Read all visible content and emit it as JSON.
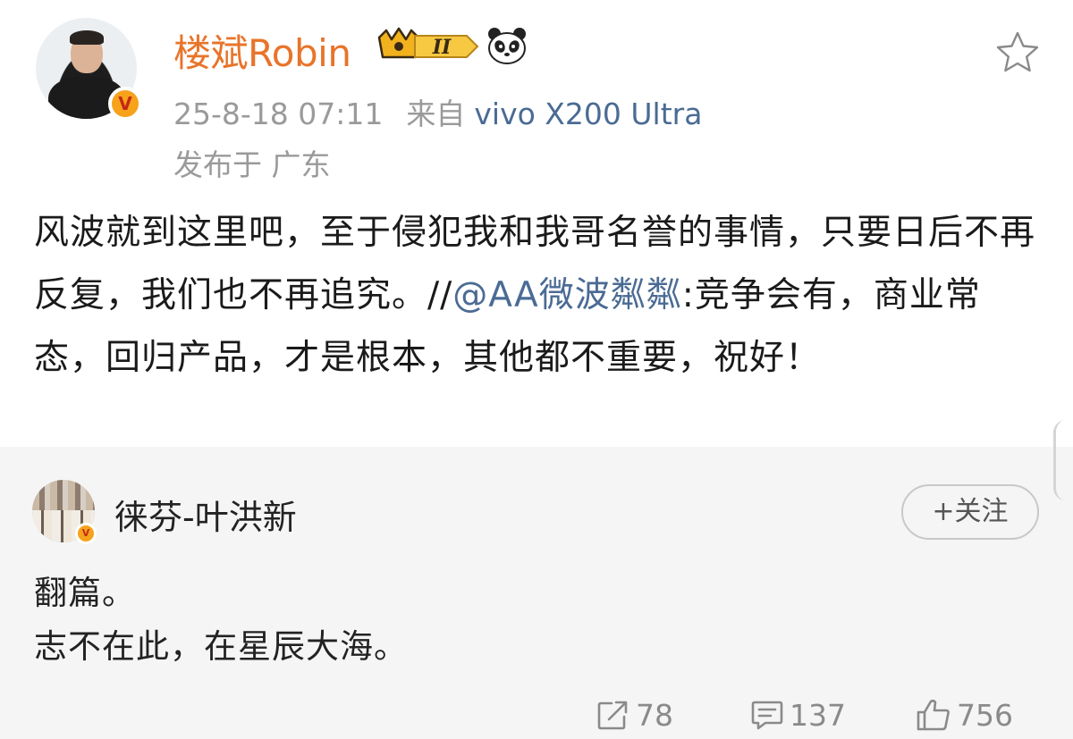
{
  "post": {
    "author": "楼斌Robin",
    "rank_badge": "II",
    "time": "25-8-18 07:11",
    "source_label": "来自",
    "device": "vivo X200 Ultra",
    "location": "发布于 广东",
    "body_text": "风波就到这里吧，至于侵犯我和我哥名誉的事情，只要日后不再反复，我们也不再追究。//",
    "mention": "@AA微波粼粼",
    "body_rest": ":竞争会有，商业常态，回归产品，才是根本，其他都不重要，祝好！",
    "verified_mark": "V"
  },
  "repost": {
    "author": "徕芬-叶洪新",
    "follow_label": "+关注",
    "lines": [
      "翻篇。",
      "志不在此，在星辰大海。"
    ],
    "verified_mark": "V"
  },
  "actions": {
    "reposts": "78",
    "comments": "137",
    "likes": "756"
  },
  "icons": {
    "favorite": "star-outline-icon",
    "rank": "crown-badge-icon",
    "emoji": "panda-icon",
    "repost": "share-icon",
    "comment": "comment-icon",
    "like": "thumbs-up-icon"
  },
  "colors": {
    "username": "#e8742a",
    "link": "#4a6b94",
    "meta": "#9a9a9a",
    "card_bg": "#f5f5f5"
  }
}
